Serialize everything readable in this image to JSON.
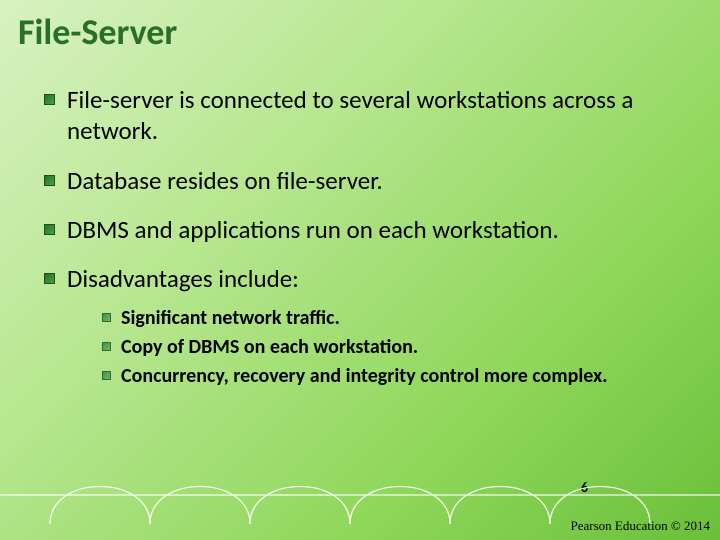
{
  "title": "File-Server",
  "bullets": [
    "File-server is connected to several workstations across a network.",
    "Database resides on file-server.",
    "DBMS and applications run on each workstation.",
    "Disadvantages include:"
  ],
  "sub_bullets": [
    "Significant network traffic.",
    "Copy of DBMS on each workstation.",
    "Concurrency, recovery and integrity control more complex."
  ],
  "page_number": "6",
  "copyright": "Pearson Education © 2014"
}
